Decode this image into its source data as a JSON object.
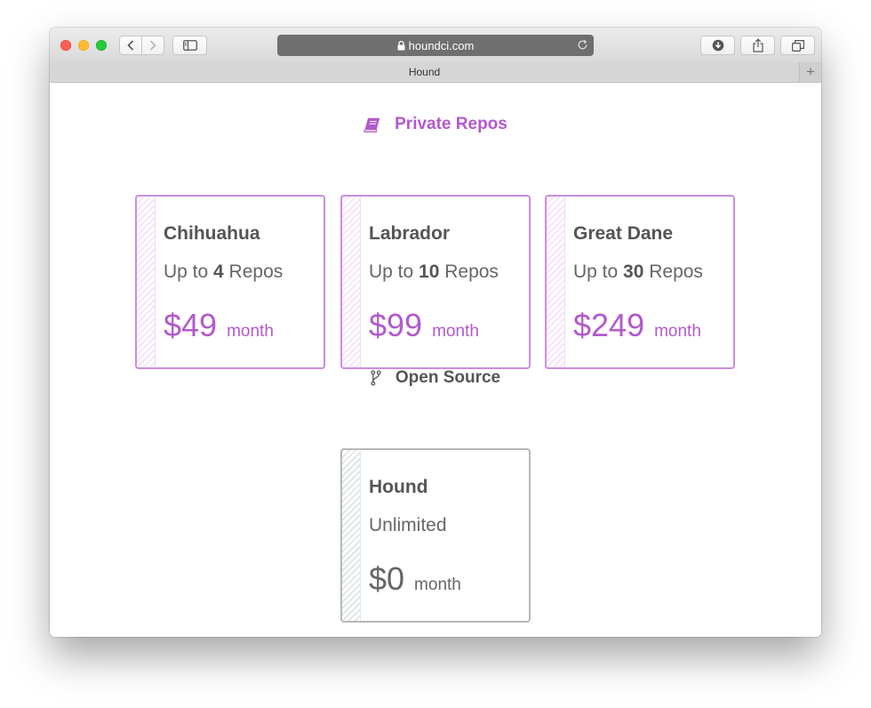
{
  "browser": {
    "url": "houndci.com",
    "tab_title": "Hound",
    "new_tab_symbol": "+"
  },
  "colors": {
    "accent": "#b359cc",
    "card_border_private": "#c98ee0",
    "card_border_open": "#b8b8b8",
    "text_dark": "#555555"
  },
  "private": {
    "title": "Private Repos",
    "icon": "book-icon",
    "plans": [
      {
        "name": "Chihuahua",
        "prefix": "Up to ",
        "count": "4",
        "suffix": " Repos",
        "price": "$49",
        "period": "month"
      },
      {
        "name": "Labrador",
        "prefix": "Up to ",
        "count": "10",
        "suffix": " Repos",
        "price": "$99",
        "period": "month"
      },
      {
        "name": "Great Dane",
        "prefix": "Up to ",
        "count": "30",
        "suffix": " Repos",
        "price": "$249",
        "period": "month"
      }
    ]
  },
  "open_source": {
    "title": "Open Source",
    "icon": "git-branch-icon",
    "plans": [
      {
        "name": "Hound",
        "limit": "Unlimited",
        "price": "$0",
        "period": "month"
      }
    ]
  }
}
